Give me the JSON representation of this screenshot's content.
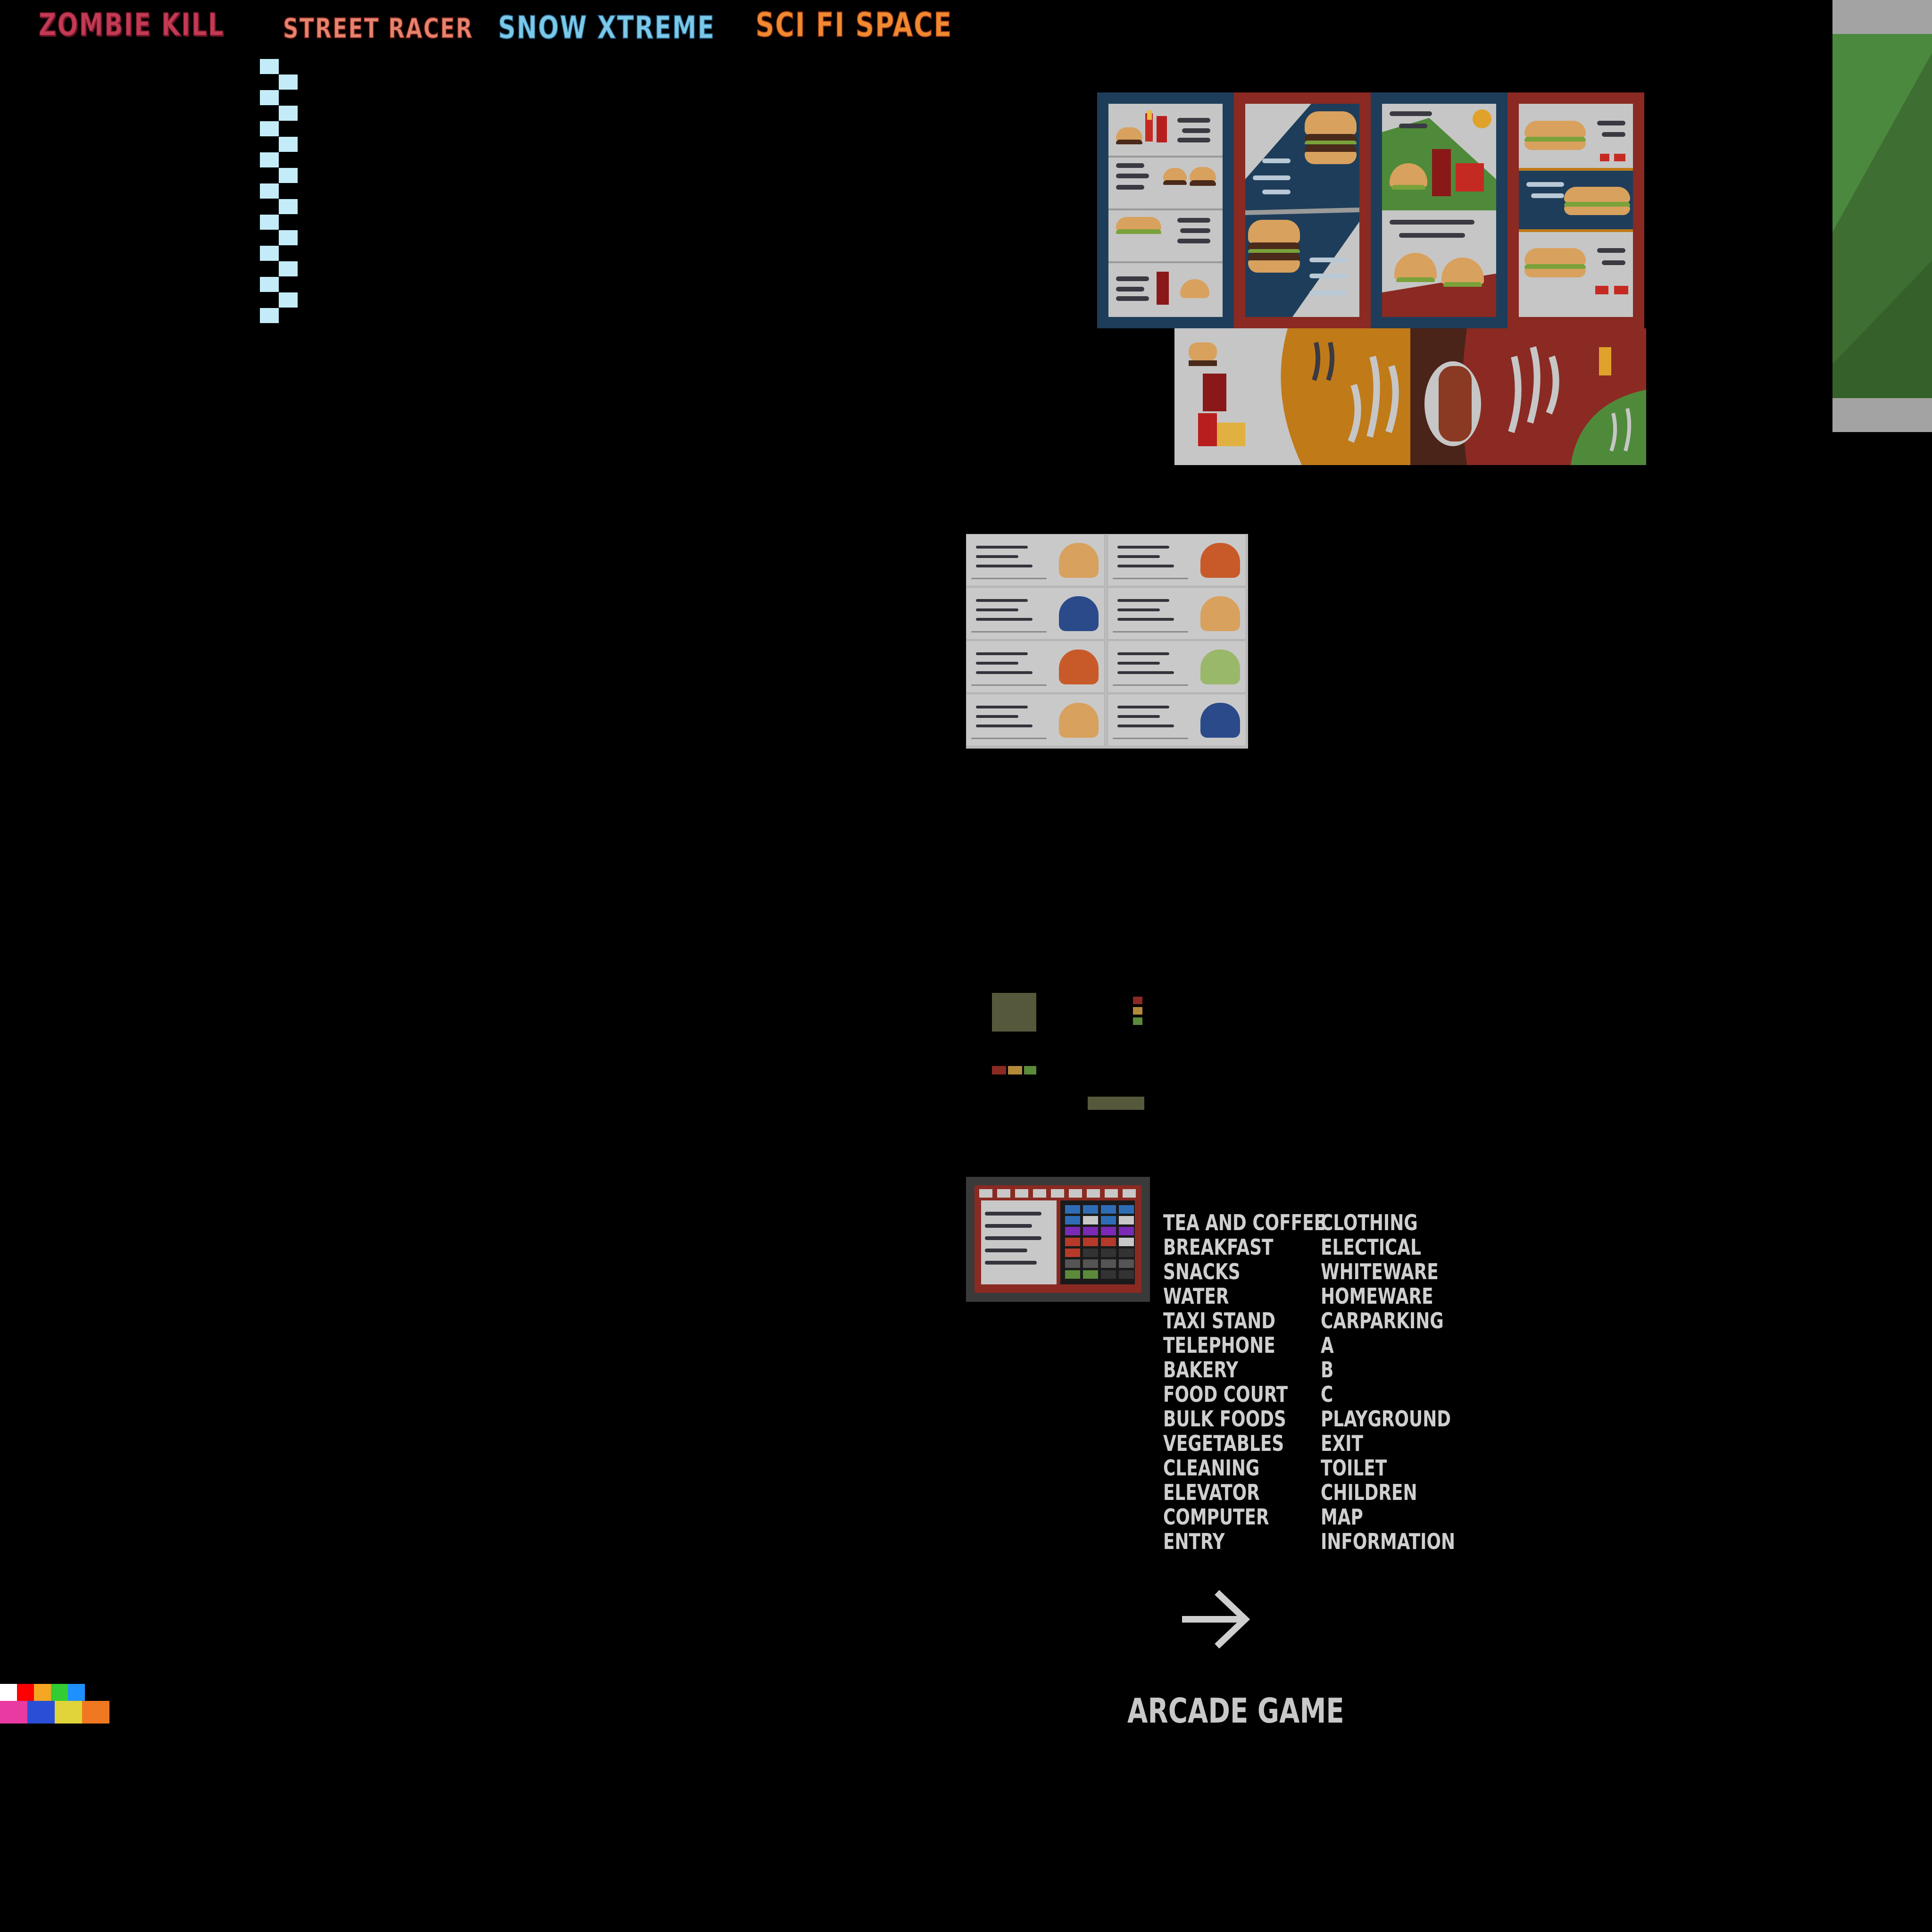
{
  "logos": {
    "zombie_kill": "ZOMBIE KILL",
    "street_racer": "STREET RACER",
    "snow_xtreme": "SNOW XTREME",
    "sci_fi_space": "SCI FI SPACE"
  },
  "signs": {
    "left": [
      "TEA AND COFFEE",
      "BREAKFAST",
      "SNACKS",
      "WATER",
      "TAXI STAND",
      "TELEPHONE",
      "BAKERY",
      "FOOD COURT",
      "BULK FOODS",
      "VEGETABLES",
      "CLEANING",
      "ELEVATOR",
      "COMPUTER",
      "ENTRY"
    ],
    "right": [
      "CLOTHING",
      "ELECTICAL",
      "WHITEWARE",
      "HOMEWARE",
      "CARPARKING",
      "A",
      "B",
      "C",
      "PLAYGROUND",
      "EXIT",
      "TOILET",
      "CHILDREN",
      "MAP",
      "INFORMATION"
    ]
  },
  "arcade_label": "ARCADE GAME",
  "palette": {
    "top": [
      "#ffffff",
      "#ff0000",
      "#f5a623",
      "#33cc33",
      "#1e90ff"
    ],
    "bottom": [
      "#e83aa0",
      "#2a4fd6",
      "#e0d43a",
      "#f07820"
    ]
  },
  "colors": {
    "background": "#000000",
    "sign_text": "#cfcfcf",
    "checker": "#c4ecf8",
    "poster_blue": "#1e3d5a",
    "poster_red": "#8a2a22",
    "poster_orange": "#c07a18",
    "panel_green": "#3e6e32"
  },
  "icons": {
    "arrow": "arrow-right-icon"
  }
}
